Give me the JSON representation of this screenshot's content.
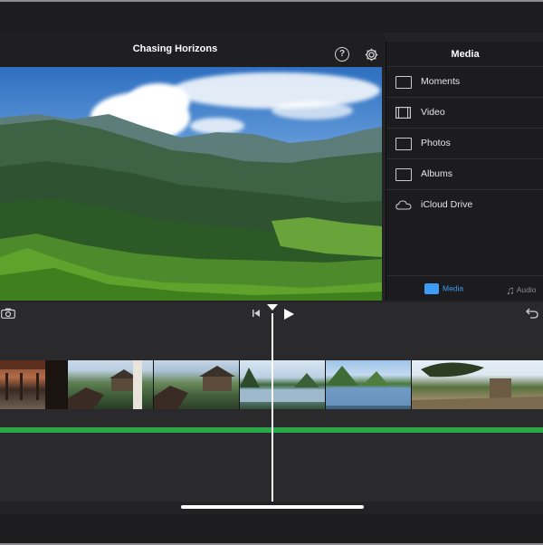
{
  "header": {
    "title": "Chasing Horizons",
    "help_icon": "help-icon",
    "settings_icon": "gear-icon"
  },
  "media_panel": {
    "title": "Media",
    "items": [
      {
        "label": "Moments",
        "icon": "moments-icon"
      },
      {
        "label": "Video",
        "icon": "film-icon"
      },
      {
        "label": "Photos",
        "icon": "photo-icon"
      },
      {
        "label": "Albums",
        "icon": "albums-icon"
      },
      {
        "label": "iCloud Drive",
        "icon": "cloud-icon"
      }
    ],
    "tabs": [
      {
        "label": "Media",
        "selected": true
      },
      {
        "label": "Audio",
        "selected": false
      }
    ]
  },
  "timeline": {
    "controls": [
      "camera-icon",
      "skip-to-start-icon",
      "play-icon",
      "undo-icon"
    ]
  },
  "colors": {
    "accent": "#3d9bf3",
    "track": "#2aa747",
    "background": "#2a2a2c"
  }
}
